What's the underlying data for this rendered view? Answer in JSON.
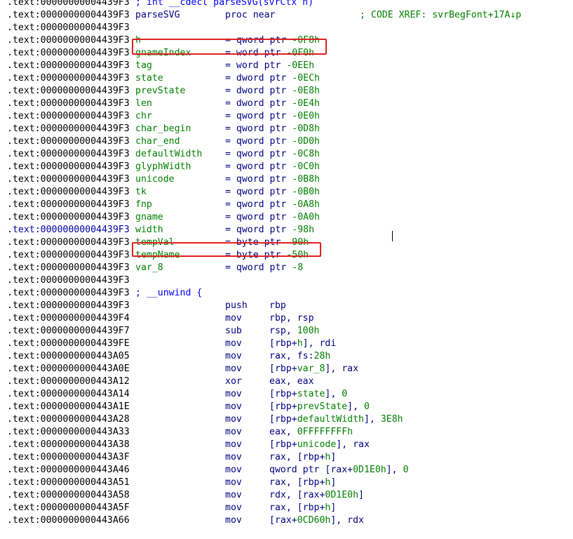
{
  "segment_prefix": ".text:",
  "lines": [
    {
      "addr": "00000000004439F3",
      "kind": "comment",
      "text": "; int __cdecl parseSVG(svrCtx h)"
    },
    {
      "addr": "00000000004439F3",
      "kind": "proc",
      "name": "parseSVG",
      "mnem": "proc near",
      "xref": "; CODE XREF: svrBegFont+17A↓p"
    },
    {
      "addr": "00000000004439F3",
      "kind": "blank"
    },
    {
      "addr": "00000000004439F3",
      "kind": "var",
      "name": "h",
      "def": "= qword ptr -0F8h"
    },
    {
      "addr": "00000000004439F3",
      "kind": "var",
      "name": "gnameIndex",
      "def": "= word ptr -0F0h"
    },
    {
      "addr": "00000000004439F3",
      "kind": "var",
      "name": "tag",
      "def": "= word ptr -0EEh"
    },
    {
      "addr": "00000000004439F3",
      "kind": "var",
      "name": "state",
      "def": "= dword ptr -0ECh"
    },
    {
      "addr": "00000000004439F3",
      "kind": "var",
      "name": "prevState",
      "def": "= dword ptr -0E8h"
    },
    {
      "addr": "00000000004439F3",
      "kind": "var",
      "name": "len",
      "def": "= dword ptr -0E4h"
    },
    {
      "addr": "00000000004439F3",
      "kind": "var",
      "name": "chr",
      "def": "= qword ptr -0E0h"
    },
    {
      "addr": "00000000004439F3",
      "kind": "var",
      "name": "char_begin",
      "def": "= qword ptr -0D8h"
    },
    {
      "addr": "00000000004439F3",
      "kind": "var",
      "name": "char_end",
      "def": "= qword ptr -0D0h"
    },
    {
      "addr": "00000000004439F3",
      "kind": "var",
      "name": "defaultWidth",
      "def": "= qword ptr -0C8h"
    },
    {
      "addr": "00000000004439F3",
      "kind": "var",
      "name": "glyphWidth",
      "def": "= qword ptr -0C0h"
    },
    {
      "addr": "00000000004439F3",
      "kind": "var",
      "name": "unicode",
      "def": "= qword ptr -0B8h"
    },
    {
      "addr": "00000000004439F3",
      "kind": "var",
      "name": "tk",
      "def": "= qword ptr -0B0h"
    },
    {
      "addr": "00000000004439F3",
      "kind": "var",
      "name": "fnp",
      "def": "= qword ptr -0A8h"
    },
    {
      "addr": "00000000004439F3",
      "kind": "var",
      "name": "gname",
      "def": "= qword ptr -0A0h"
    },
    {
      "addr": "00000000004439F3",
      "kind": "var",
      "name": "width",
      "def": "= qword ptr -98h",
      "addr_highlight": true
    },
    {
      "addr": "00000000004439F3",
      "kind": "var",
      "name": "tempVal",
      "def": "= byte ptr -90h"
    },
    {
      "addr": "00000000004439F3",
      "kind": "var",
      "name": "tempName",
      "def": "= byte ptr -50h"
    },
    {
      "addr": "00000000004439F3",
      "kind": "var",
      "name": "var_8",
      "def": "= qword ptr -8"
    },
    {
      "addr": "00000000004439F3",
      "kind": "blank"
    },
    {
      "addr": "00000000004439F3",
      "kind": "comment",
      "text": "; __unwind {"
    },
    {
      "addr": "00000000004439F3",
      "kind": "instr",
      "mnem": "push",
      "ops": "rbp"
    },
    {
      "addr": "00000000004439F4",
      "kind": "instr",
      "mnem": "mov",
      "ops": "rbp, rsp"
    },
    {
      "addr": "00000000004439F7",
      "kind": "instr",
      "mnem": "sub",
      "ops": "rsp, 100h"
    },
    {
      "addr": "00000000004439FE",
      "kind": "instr",
      "mnem": "mov",
      "ops": "[rbp+h], rdi"
    },
    {
      "addr": "0000000000443A05",
      "kind": "instr",
      "mnem": "mov",
      "ops": "rax, fs:28h"
    },
    {
      "addr": "0000000000443A0E",
      "kind": "instr",
      "mnem": "mov",
      "ops": "[rbp+var_8], rax"
    },
    {
      "addr": "0000000000443A12",
      "kind": "instr",
      "mnem": "xor",
      "ops": "eax, eax"
    },
    {
      "addr": "0000000000443A14",
      "kind": "instr",
      "mnem": "mov",
      "ops": "[rbp+state], 0"
    },
    {
      "addr": "0000000000443A1E",
      "kind": "instr",
      "mnem": "mov",
      "ops": "[rbp+prevState], 0"
    },
    {
      "addr": "0000000000443A28",
      "kind": "instr",
      "mnem": "mov",
      "ops": "[rbp+defaultWidth], 3E8h"
    },
    {
      "addr": "0000000000443A33",
      "kind": "instr",
      "mnem": "mov",
      "ops": "eax, 0FFFFFFFFh"
    },
    {
      "addr": "0000000000443A38",
      "kind": "instr",
      "mnem": "mov",
      "ops": "[rbp+unicode], rax"
    },
    {
      "addr": "0000000000443A3F",
      "kind": "instr",
      "mnem": "mov",
      "ops": "rax, [rbp+h]"
    },
    {
      "addr": "0000000000443A46",
      "kind": "instr",
      "mnem": "mov",
      "ops": "qword ptr [rax+0D1E0h], 0"
    },
    {
      "addr": "0000000000443A51",
      "kind": "instr",
      "mnem": "mov",
      "ops": "rax, [rbp+h]"
    },
    {
      "addr": "0000000000443A58",
      "kind": "instr",
      "mnem": "mov",
      "ops": "rdx, [rax+0D1E0h]"
    },
    {
      "addr": "0000000000443A5F",
      "kind": "instr",
      "mnem": "mov",
      "ops": "rax, [rbp+h]"
    },
    {
      "addr": "0000000000443A66",
      "kind": "instr",
      "mnem": "mov",
      "ops": "[rax+0CD60h], rdx"
    }
  ],
  "colors": {
    "address": "#000000",
    "mnemonic": "#000080",
    "comment": "#0000ff",
    "local_var_name": "#008000",
    "number": "#008000",
    "highlight_box": "#e02020"
  }
}
